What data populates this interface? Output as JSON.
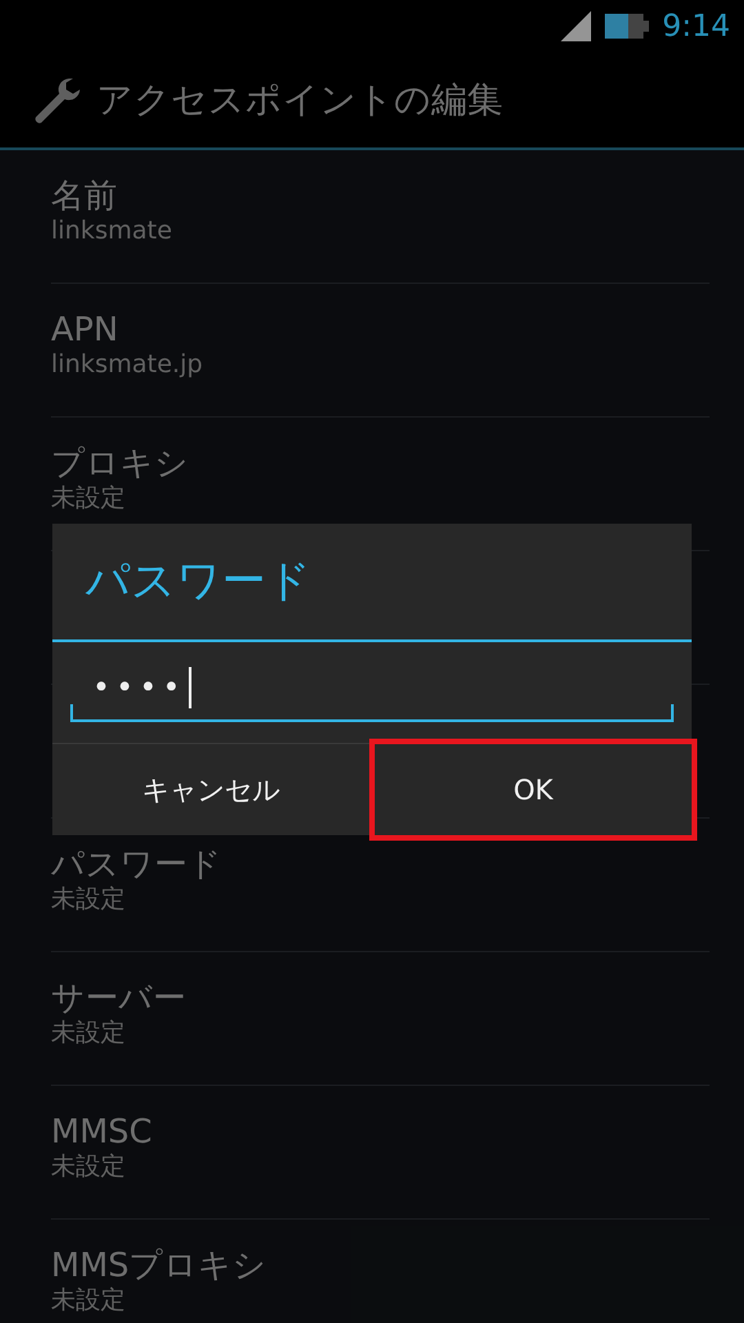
{
  "status_bar": {
    "time": "9:14"
  },
  "action_bar": {
    "title": "アクセスポイントの編集"
  },
  "rows": [
    {
      "kind": "item",
      "title": "名前",
      "value": "linksmate"
    },
    {
      "kind": "item",
      "title": "APN",
      "value": "linksmate.jp"
    },
    {
      "kind": "item",
      "title": "プロキシ",
      "value": "未設定"
    },
    {
      "kind": "covered"
    },
    {
      "kind": "covered"
    },
    {
      "kind": "item",
      "title": "パスワード",
      "value": "未設定"
    },
    {
      "kind": "item",
      "title": "サーバー",
      "value": "未設定"
    },
    {
      "kind": "item",
      "title": "MMSC",
      "value": "未設定"
    },
    {
      "kind": "item",
      "title": "MMSプロキシ",
      "value": "未設定"
    }
  ],
  "dialog": {
    "title": "パスワード",
    "value": "••••",
    "buttons": [
      {
        "label": "キャンセル",
        "highlighted": false
      },
      {
        "label": "OK",
        "highlighted": true
      }
    ]
  }
}
